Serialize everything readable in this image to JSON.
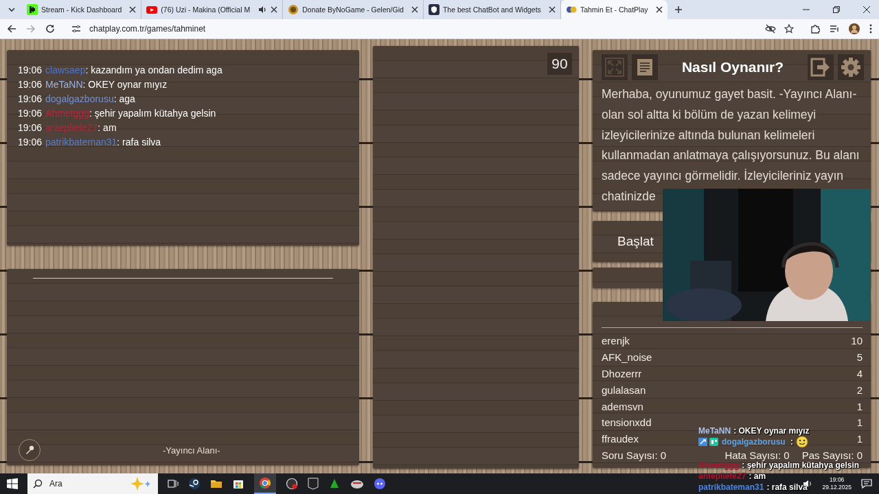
{
  "browser": {
    "tabs": [
      {
        "title": "Stream - Kick Dashboard",
        "kind": "kick",
        "audio": false,
        "selected": false
      },
      {
        "title": "(76) Uzi - Makina (Official M",
        "kind": "youtube",
        "audio": true,
        "selected": false
      },
      {
        "title": "Donate ByNoGame - Gelen/Gid",
        "kind": "coin",
        "audio": false,
        "selected": false
      },
      {
        "title": "The best ChatBot and Widgets",
        "kind": "shield",
        "audio": false,
        "selected": false
      },
      {
        "title": "Tahmin Et - ChatPlay",
        "kind": "chatplay",
        "audio": false,
        "selected": true
      }
    ],
    "address": "chatplay.com.tr/games/tahminet"
  },
  "chat": {
    "messages": [
      {
        "time": "19:06",
        "user": "clawsaep",
        "color": "#4a74c8",
        "text": ": kazandım ya ondan dedim aga"
      },
      {
        "time": "19:06",
        "user": "MeTaNN",
        "color": "#9bb3e0",
        "text": ": OKEY oynar mıyız"
      },
      {
        "time": "19:06",
        "user": "dogalgazborusu",
        "color": "#6f8fd2",
        "text": ": aga"
      },
      {
        "time": "19:06",
        "user": "Ahmetggg",
        "color": "#c4203c",
        "text": ": şehir yapalım kütahya gelsin"
      },
      {
        "time": "19:06",
        "user": "antepliefe27",
        "color": "#b3253e",
        "text": ": am"
      },
      {
        "time": "19:06",
        "user": "patrikbateman31",
        "color": "#4f7fd2",
        "text": ": rafa silva"
      }
    ]
  },
  "host_area": {
    "label": "-Yayıncı Alanı-"
  },
  "timer": "90",
  "how_to": {
    "title": "Nasıl Oynanır?",
    "text": "Merhaba, oyunumuz gayet basit. -Yayıncı Alanı- olan sol altta ki bölüm de yazan kelimeyi izleyicilerinize altında bulunan kelimeleri kullanmadan anlatmaya çalışıyorsunuz. Bu alanı sadece yayıncı görmelidir. İzleyicileriniz yayın chatinizde"
  },
  "start_button": "Başlat",
  "leaderboard": {
    "rows": [
      {
        "name": "erenjk",
        "score": "10"
      },
      {
        "name": "AFK_noise",
        "score": "5"
      },
      {
        "name": "Dhozerrr",
        "score": "4"
      },
      {
        "name": "gulalasan",
        "score": "2"
      },
      {
        "name": "ademsvn",
        "score": "1"
      },
      {
        "name": "tensionxdd",
        "score": "1"
      },
      {
        "name": "ffraudex",
        "score": "1"
      }
    ],
    "questions": "Soru Sayısı: 0",
    "errors": "Hata Sayısı: 0",
    "passes": "Pas Sayısı: 0"
  },
  "stream_chat": [
    {
      "user": "MeTaNN",
      "color": "#a9c1ea",
      "text": ": OKEY oynar mıyız",
      "kind": "text",
      "badges": false
    },
    {
      "user": "dogalgazborusu",
      "color": "#5aa2e6",
      "text": " :",
      "kind": "emoji",
      "badges": true
    },
    {
      "user": "Ahmetggg",
      "color": "#b3112f",
      "text": ": şehir yapalım kütahya gelsin",
      "kind": "text",
      "badges": false
    },
    {
      "user": "antepliefe27",
      "color": "#b3112f",
      "text": ": am",
      "kind": "text",
      "badges": false
    },
    {
      "user": "patrikbateman31",
      "color": "#4a86e6",
      "text": ": rafa silva",
      "kind": "text",
      "badges": false
    }
  ],
  "taskbar": {
    "search_placeholder": "Ara",
    "time": "19:06",
    "date": "29.12.2025"
  }
}
